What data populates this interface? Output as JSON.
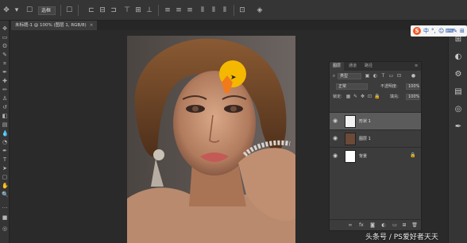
{
  "options_bar": {
    "mode_select": "选框",
    "icons": [
      "move-tool-icon",
      "dropdown-arrow-icon",
      "auto-select-icon",
      "align-left-icon",
      "align-center-icon",
      "align-right-icon",
      "align-top-icon",
      "align-middle-icon",
      "align-bottom-icon",
      "distribute-icon",
      "distribute-icon",
      "distribute-icon",
      "distribute-icon",
      "distribute-icon",
      "distribute-icon",
      "auto-align-icon",
      "3d-mode-icon"
    ]
  },
  "document_tab": {
    "label": "未标题-1 @ 100% (图层 1, RGB/8)",
    "close": "×"
  },
  "ime_bar": {
    "logo": "S",
    "items": [
      "中",
      "°,",
      "☺",
      "⌨",
      "✎",
      "👕",
      "⊞"
    ]
  },
  "layers_panel": {
    "tabs": [
      "图层",
      "通道",
      "路径"
    ],
    "filter_kind": "类型",
    "blend_mode": "正常",
    "opacity_label": "不透明度:",
    "opacity_value": "100%",
    "lock_label": "锁定:",
    "fill_label": "填充:",
    "fill_value": "100%",
    "layers": [
      {
        "name": "形状 1",
        "selected": true,
        "locked": false
      },
      {
        "name": "图层 1",
        "selected": false,
        "locked": false
      },
      {
        "name": "背景",
        "selected": false,
        "locked": true
      }
    ],
    "footer_icons": [
      "link-icon",
      "fx-icon",
      "mask-icon",
      "adjustment-icon",
      "group-icon",
      "new-layer-icon",
      "trash-icon"
    ]
  },
  "colors": {
    "shape_yellow": "#f5b800",
    "shape_orange": "#f07a1c",
    "ui_dark": "#2a2a2a",
    "panel": "#3c3c3c"
  },
  "watermark": "头条号 / PS爱好者天天"
}
